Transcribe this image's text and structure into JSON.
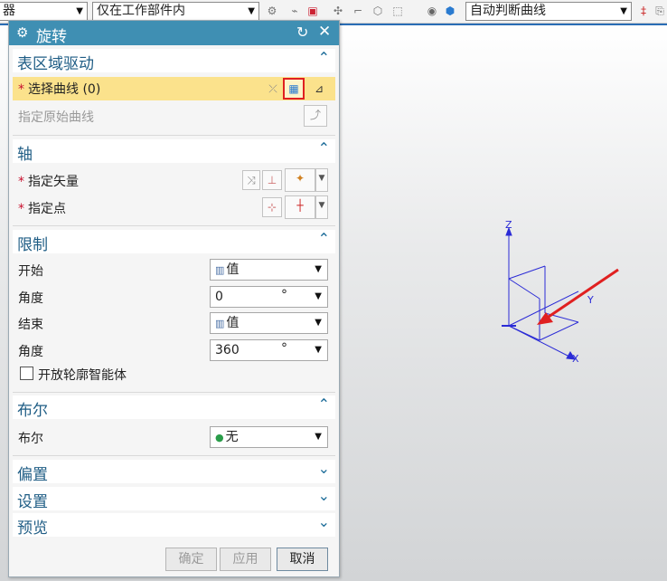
{
  "toolbar": {
    "filter_combo": "器",
    "scope_combo": "仅在工作部件内",
    "curve_rule_combo": "自动判断曲线",
    "icons": [
      "snap-icon",
      "link-icon",
      "select-icon",
      "node-icon",
      "point-icon",
      "box-select-icon",
      "shaded-icon",
      "cube-icon",
      "pin-icon",
      "extra-icon"
    ]
  },
  "dialog": {
    "title": "旋转",
    "sections": {
      "section": {
        "title": "表区域驱动",
        "select_curve": "选择曲线 (0)",
        "specify_curve": "指定原始曲线"
      },
      "axis": {
        "title": "轴",
        "vector": "指定矢量",
        "point": "指定点"
      },
      "limits": {
        "title": "限制",
        "start_label": "开始",
        "start_value": "值",
        "start_angle_label": "角度",
        "start_angle": "0",
        "end_label": "结束",
        "end_value": "值",
        "end_angle_label": "角度",
        "end_angle": "360",
        "unit": "°",
        "open_profile": "开放轮廓智能体"
      },
      "boolean": {
        "title": "布尔",
        "label": "布尔",
        "value": "无"
      },
      "offset": {
        "title": "偏置"
      },
      "settings": {
        "title": "设置"
      },
      "preview": {
        "title": "预览"
      }
    },
    "buttons": {
      "ok": "确定",
      "apply": "应用",
      "cancel": "取消"
    }
  },
  "viewport": {
    "axis_z": "Z",
    "axis_y": "Y",
    "axis_x": "X",
    "triad_color": "#2b2bd6",
    "arrow_color": "#e02020"
  }
}
